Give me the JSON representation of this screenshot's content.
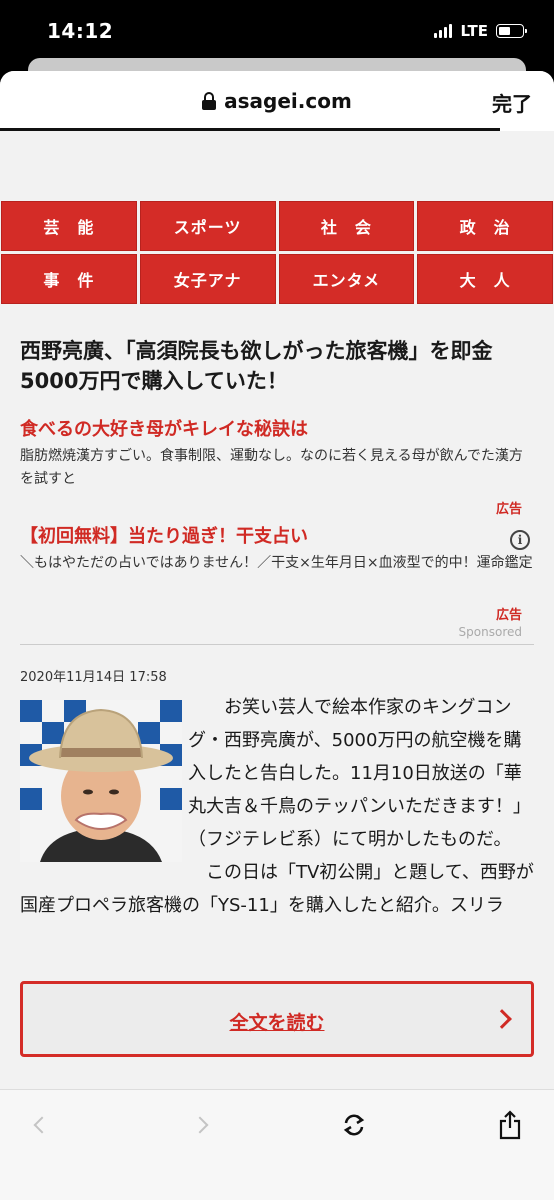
{
  "status": {
    "time": "14:12",
    "network": "LTE"
  },
  "browser": {
    "url": "asagei.com",
    "done_label": "完了"
  },
  "categories": [
    "芸　能",
    "スポーツ",
    "社　会",
    "政　治",
    "事　件",
    "女子アナ",
    "エンタメ",
    "大　人"
  ],
  "article": {
    "headline": "西野亮廣、「高須院長も欲しがった旅客機」を即金5000万円で購入していた！",
    "date": "2020年11月14日 17:58",
    "body_p1": "お笑い芸人で絵本作家のキングコング・西野亮廣が、5000万円の航空機を購入したと告白した。11月10日放送の「華丸大吉＆千鳥のテッパンいただきます！」（フジテレビ系）にて明かしたものだ。",
    "body_p2": "この日は「TV初公開」と題して、西野が国産プロペラ旅客機の「YS-11」を購入したと紹介。スリラ",
    "read_more": "全文を読む"
  },
  "ads": [
    {
      "title": "食べるの大好き母がキレイな秘訣は",
      "desc": "脂肪燃焼漢方すごい。食事制限、運動なし。なのに若く見える母が飲んでた漢方を試すと",
      "label": "広告"
    },
    {
      "title": "【初回無料】当たり過ぎ！干支占い",
      "desc": "＼もはやただの占いではありません！／干支×生年月日×血液型で的中！運命鑑定",
      "label": "広告"
    }
  ],
  "sponsored_label": "Sponsored",
  "colors": {
    "accent": "#d42c27",
    "ad_text": "#d02a24"
  }
}
